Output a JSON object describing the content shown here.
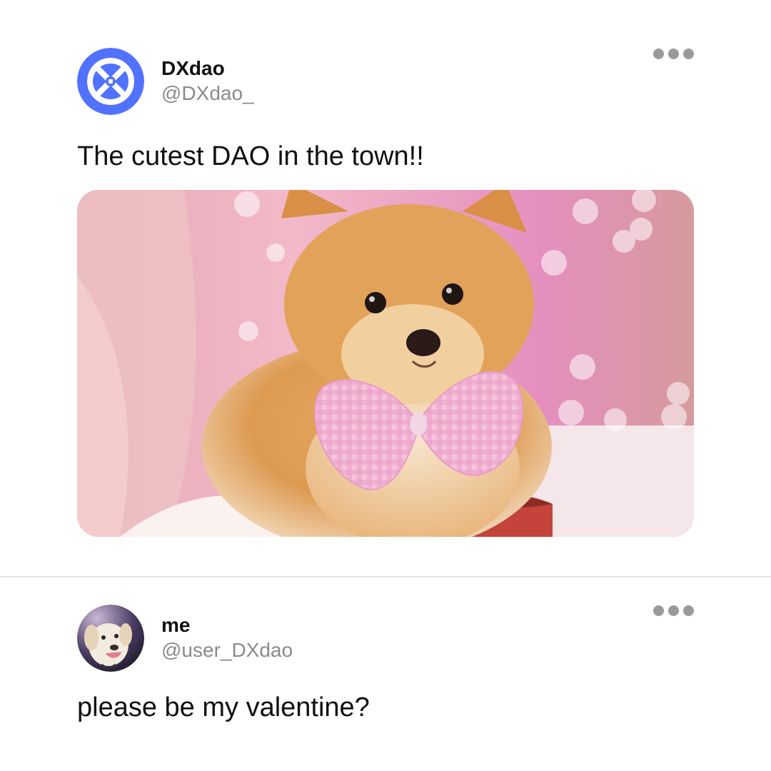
{
  "posts": [
    {
      "display_name": "DXdao",
      "handle": "@DXdao_",
      "text": "The cutest DAO in the town!!",
      "avatar_icon": "dxdao-logo",
      "avatar_color": "#5172ff",
      "media_description_icon": "pomeranian-puppy-photo"
    },
    {
      "display_name": "me",
      "handle": "@user_DXdao",
      "text": "please be my valentine?",
      "avatar_icon": "labrador-dog-photo"
    }
  ],
  "more_icon": "more-options-icon",
  "colors": {
    "handle": "#8a8a8a",
    "divider": "#e4e4e4",
    "more_dots": "#9a9a9a"
  }
}
